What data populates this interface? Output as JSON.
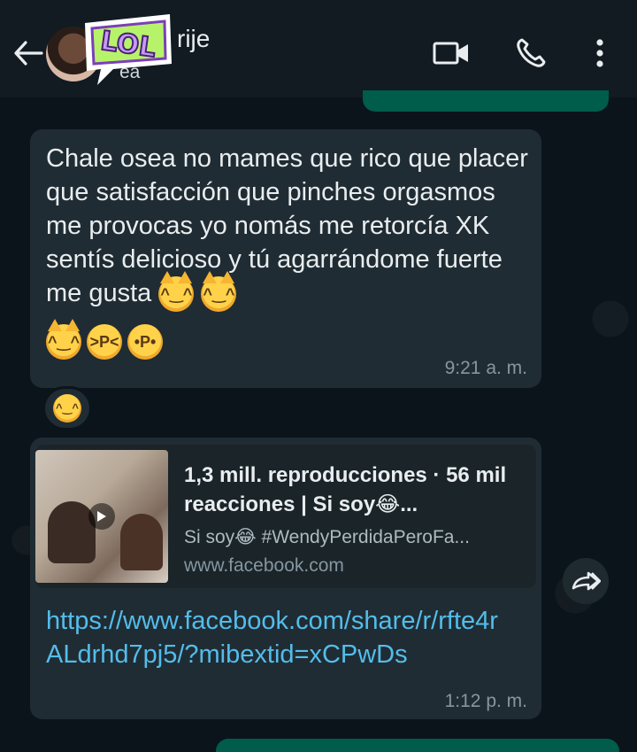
{
  "header": {
    "contact_name": "rije",
    "contact_status": "ea",
    "sticker_text": "LOL",
    "icons": [
      "back-arrow-icon",
      "video-call-icon",
      "phone-icon",
      "more-vert-icon"
    ]
  },
  "messages": [
    {
      "text": "Chale osea no mames que rico que placer que satisfacción que pinches orgasmos me provocas yo nomás me retorcía XK sentís delicioso y tú agarrándome fuerte me gusta",
      "time": "9:21 a. m.",
      "reaction": "drooling-face-emoji"
    },
    {
      "preview_title": "1,3 mill. reproducciones · 56 mil reacciones | Si soy😂...",
      "preview_desc": "Si soy😂 #WendyPerdidaPeroFa...",
      "preview_domain": "www.facebook.com",
      "link": "https://www.facebook.com/share/r/rfte4rALdrhd7pj5/?mibextid=xCPwDs",
      "time": "1:12 p. m."
    }
  ],
  "colors": {
    "background": "#0b141a",
    "header": "#111b21",
    "incoming_bubble": "#202c33",
    "outgoing_bubble": "#005c4b",
    "link": "#53bdeb"
  }
}
